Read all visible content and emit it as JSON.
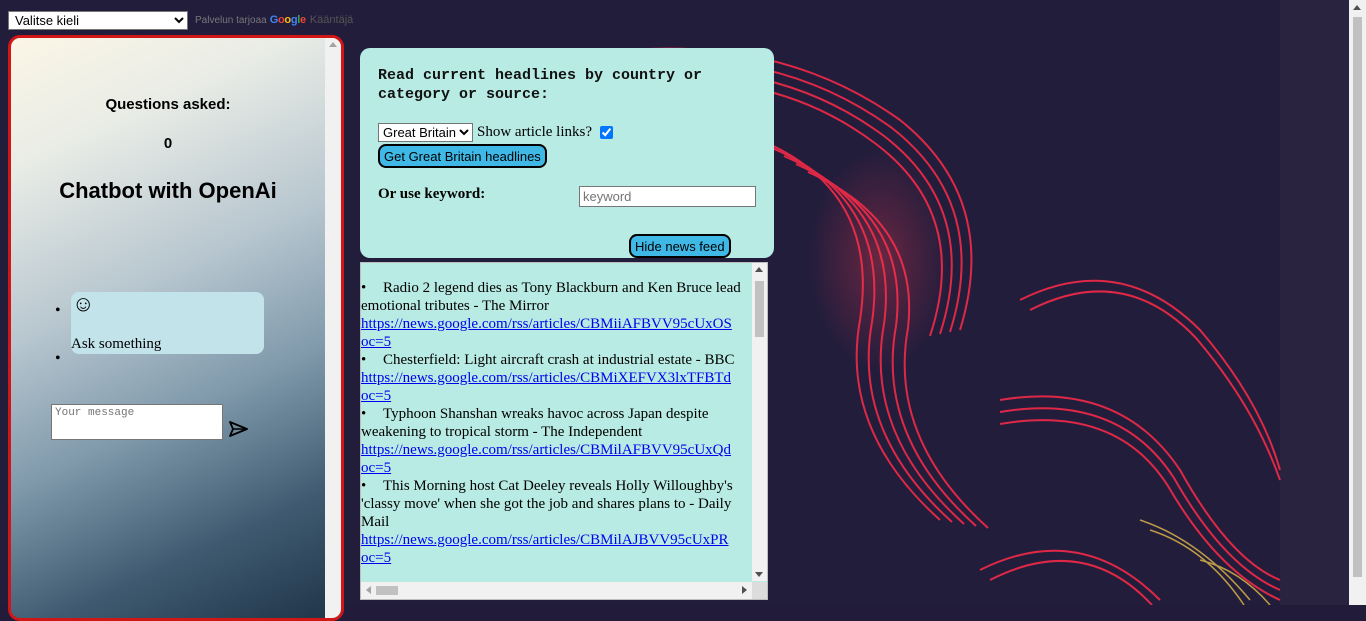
{
  "translate": {
    "select_value": "Valitse kieli",
    "powered_by": "Palvelun tarjoaa",
    "google": [
      "G",
      "o",
      "o",
      "g",
      "l",
      "e"
    ],
    "translate_label": "Kääntäjä"
  },
  "chat": {
    "questions_label": "Questions asked:",
    "questions_count": "0",
    "title": "Chatbot with OpenAi",
    "greeting_icon": "☺",
    "greeting_text": "Ask something",
    "message_placeholder": "Your message",
    "send_icon": "send-arrow-icon"
  },
  "news": {
    "heading": "Read current headlines by country or category or source:",
    "country_selected": "Great Britain",
    "show_links_label": "Show article links?",
    "show_links_checked": true,
    "get_button": "Get Great Britain headlines",
    "keyword_label": "Or use keyword:",
    "keyword_placeholder": "keyword",
    "hide_button": "Hide news feed"
  },
  "feed": {
    "items": [
      {
        "title": "Radio 2 legend dies as Tony Blackburn and Ken Bruce lead emotional tributes - The Mirror",
        "link": "https://news.google.com/rss/articles/CBMiiAFBVV95cUxOS",
        "link_tail": "oc=5"
      },
      {
        "title": "Chesterfield: Light aircraft crash at industrial estate - BBC",
        "link": "https://news.google.com/rss/articles/CBMiXEFVX3lxTFBTd",
        "link_tail": "oc=5"
      },
      {
        "title": "Typhoon Shanshan wreaks havoc across Japan despite weakening to tropical storm - The Independent",
        "link": "https://news.google.com/rss/articles/CBMilAFBVV95cUxQd",
        "link_tail": "oc=5"
      },
      {
        "title": "This Morning host Cat Deeley reveals Holly Willoughby's 'classy move' when she got the job and shares plans to - Daily Mail",
        "link": "https://news.google.com/rss/articles/CBMilAJBVV95cUxPR",
        "link_tail": "oc=5"
      }
    ]
  }
}
